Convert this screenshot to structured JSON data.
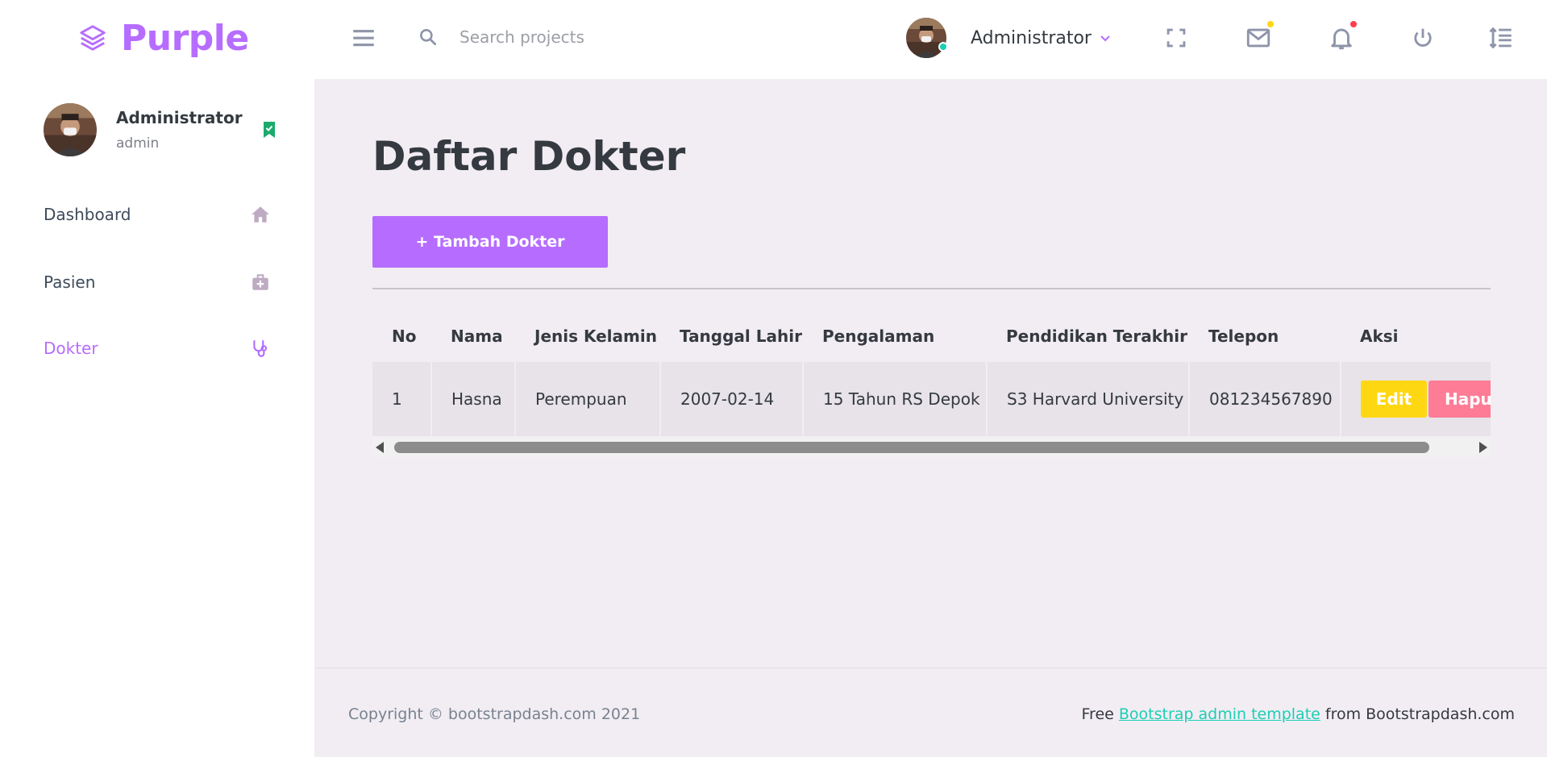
{
  "brand": {
    "name": "Purple"
  },
  "navbar": {
    "search_placeholder": "Search projects",
    "profile_name": "Administrator",
    "colors": {
      "online": "#1bcfb4",
      "mail_dot": "#fed713",
      "bell_dot": "#fe3d4e"
    }
  },
  "sidebar": {
    "user": {
      "name": "Administrator",
      "role": "admin"
    },
    "items": [
      {
        "label": "Dashboard",
        "icon": "home-icon",
        "active": false
      },
      {
        "label": "Pasien",
        "icon": "medical-bag-icon",
        "active": false
      },
      {
        "label": "Dokter",
        "icon": "stethoscope-icon",
        "active": true
      }
    ]
  },
  "main": {
    "title": "Daftar Dokter",
    "add_button": "+ Tambah Dokter",
    "table": {
      "headers": [
        "No",
        "Nama",
        "Jenis Kelamin",
        "Tanggal Lahir",
        "Pengalaman",
        "Pendidikan Terakhir",
        "Telepon",
        "Aksi"
      ],
      "rows": [
        {
          "no": "1",
          "nama": "Hasna",
          "jenis_kelamin": "Perempuan",
          "tanggal_lahir": "2007-02-14",
          "pengalaman": "15 Tahun RS Depok",
          "pendidikan": "S3 Harvard University",
          "telepon": "081234567890",
          "edit_label": "Edit",
          "delete_label": "Hapus"
        }
      ]
    }
  },
  "footer": {
    "copyright": "Copyright © bootstrapdash.com 2021",
    "free_text": "Free ",
    "link_text": "Bootstrap admin template",
    "suffix_text": " from Bootstrapdash.com"
  },
  "theme": {
    "accent": "#b66dff",
    "edit": "#fed713",
    "delete": "#fe7c96",
    "background": "#f2edf3"
  }
}
